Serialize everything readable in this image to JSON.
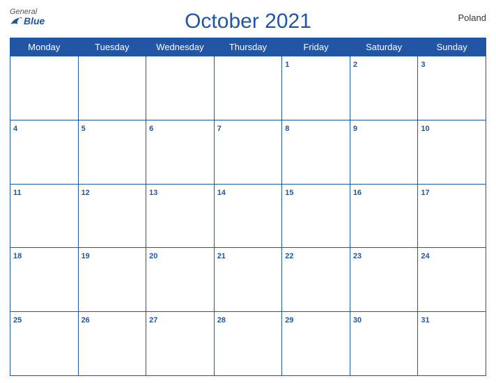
{
  "header": {
    "logo_general": "General",
    "logo_blue": "Blue",
    "title": "October 2021",
    "country": "Poland"
  },
  "weekdays": [
    "Monday",
    "Tuesday",
    "Wednesday",
    "Thursday",
    "Friday",
    "Saturday",
    "Sunday"
  ],
  "weeks": [
    {
      "week_start": null,
      "days": [
        null,
        null,
        null,
        null,
        "1",
        "2",
        "3"
      ]
    },
    {
      "days": [
        "4",
        "5",
        "6",
        "7",
        "8",
        "9",
        "10"
      ]
    },
    {
      "days": [
        "11",
        "12",
        "13",
        "14",
        "15",
        "16",
        "17"
      ]
    },
    {
      "days": [
        "18",
        "19",
        "20",
        "21",
        "22",
        "23",
        "24"
      ]
    },
    {
      "days": [
        "25",
        "26",
        "27",
        "28",
        "29",
        "30",
        "31"
      ]
    }
  ],
  "colors": {
    "header_bg": "#2255a4",
    "header_text": "#ffffff",
    "day_num": "#2255a4",
    "border": "#2255a4"
  }
}
